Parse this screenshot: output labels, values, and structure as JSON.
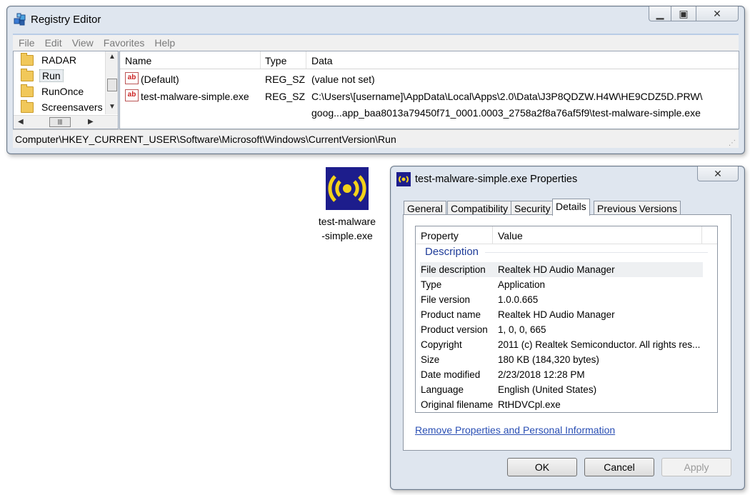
{
  "registry": {
    "title": "Registry Editor",
    "menu": [
      "File",
      "Edit",
      "View",
      "Favorites",
      "Help"
    ],
    "tree": [
      {
        "label": "RADAR"
      },
      {
        "label": "Run"
      },
      {
        "label": "RunOnce"
      },
      {
        "label": "Screensavers"
      }
    ],
    "columns": {
      "name": "Name",
      "type": "Type",
      "data": "Data"
    },
    "rows": [
      {
        "name": "(Default)",
        "type": "REG_SZ",
        "data": "(value not set)"
      },
      {
        "name": "test-malware-simple.exe",
        "type": "REG_SZ",
        "data_line1": "C:\\Users\\[username]\\AppData\\Local\\Apps\\2.0\\Data\\J3P8QDZW.H4W\\HE9CDZ5D.PRW\\",
        "data_line2": "goog...app_baa8013a79450f71_0001.0003_2758a2f8a76af5f9\\test-malware-simple.exe"
      }
    ],
    "status_path": "Computer\\HKEY_CURRENT_USER\\Software\\Microsoft\\Windows\\CurrentVersion\\Run"
  },
  "desktop_icon": {
    "label_line1": "test-malware",
    "label_line2": "-simple.exe"
  },
  "properties": {
    "title": "test-malware-simple.exe Properties",
    "tabs": [
      "General",
      "Compatibility",
      "Security",
      "Details",
      "Previous Versions"
    ],
    "active_tab": "Details",
    "columns": {
      "property": "Property",
      "value": "Value"
    },
    "group": "Description",
    "rows": [
      {
        "property": "File description",
        "value": "Realtek HD Audio Manager"
      },
      {
        "property": "Type",
        "value": "Application"
      },
      {
        "property": "File version",
        "value": "1.0.0.665"
      },
      {
        "property": "Product name",
        "value": "Realtek HD Audio Manager"
      },
      {
        "property": "Product version",
        "value": "1, 0, 0, 665"
      },
      {
        "property": "Copyright",
        "value": "2011 (c) Realtek Semiconductor.  All rights res..."
      },
      {
        "property": "Size",
        "value": "180 KB (184,320 bytes)"
      },
      {
        "property": "Date modified",
        "value": "2/23/2018 12:28 PM"
      },
      {
        "property": "Language",
        "value": "English (United States)"
      },
      {
        "property": "Original filename",
        "value": "RtHDVCpl.exe"
      }
    ],
    "link": "Remove Properties and Personal Information",
    "buttons": {
      "ok": "OK",
      "cancel": "Cancel",
      "apply": "Apply"
    }
  }
}
